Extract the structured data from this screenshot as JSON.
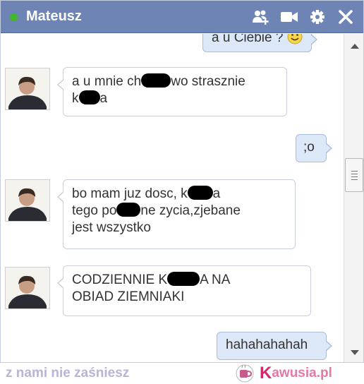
{
  "header": {
    "contact_name": "Mateusz",
    "status": "online",
    "icons": [
      "add-friends-icon",
      "video-call-icon",
      "gear-icon",
      "close-icon"
    ]
  },
  "messages": [
    {
      "from": "me",
      "text_before": "a u Ciebie ? ",
      "emoji": "smile-emoji"
    },
    {
      "from": "Mateusz",
      "line1_before": "a u mnie ch",
      "line1_after": "wo strasznie",
      "line2_before": "k",
      "line2_after": "a"
    },
    {
      "from": "me",
      "text": ";o"
    },
    {
      "from": "Mateusz",
      "line1_before": "bo mam juz dosc, k",
      "line1_after": "a",
      "line2_before": "tego po",
      "line2_after": "ne zycia,zjebane",
      "line3": "jest wszystko"
    },
    {
      "from": "Mateusz",
      "line1_before": "CODZIENNIE K",
      "line1_after": "A NA",
      "line2": "OBIAD ZIEMNIAKI"
    },
    {
      "from": "me",
      "text": "hahahahahah"
    }
  ],
  "footer": {
    "slogan": "z nami nie zaśniesz",
    "brand_initial": "K",
    "brand_rest": "awusia.pl"
  },
  "colors": {
    "titlebar": "#6d84b4",
    "online": "#42b72a",
    "outgoing_bubble": "#dce7f7",
    "brand_pink": "#d1286e"
  }
}
